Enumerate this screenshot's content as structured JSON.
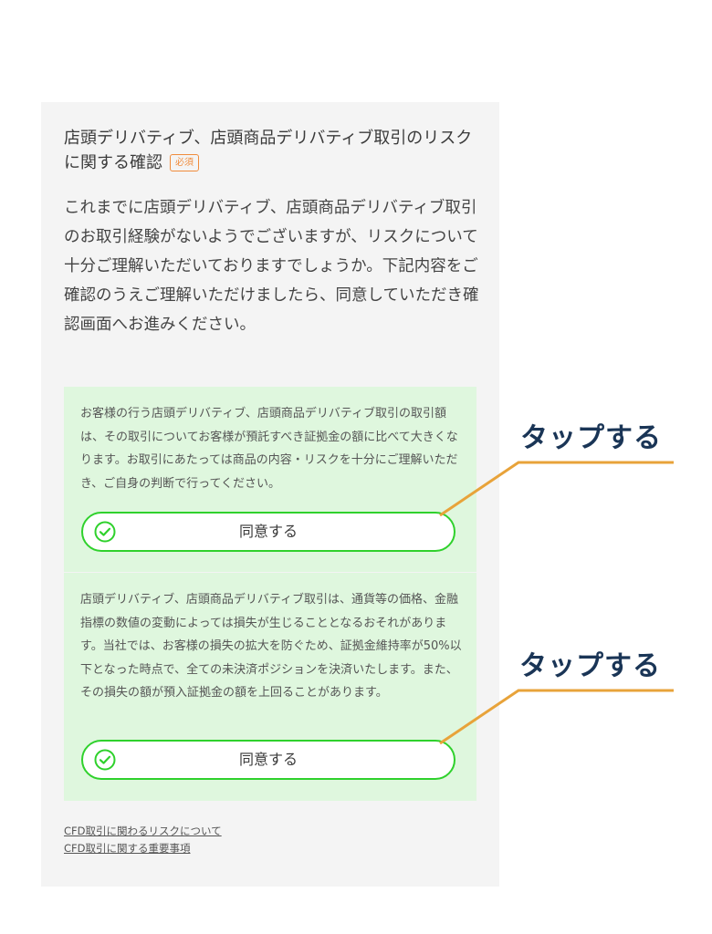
{
  "section": {
    "title": "店頭デリバティブ、店頭商品デリバティブ取引のリスクに関する確認",
    "required_badge": "必須",
    "intro": "これまでに店頭デリバティブ、店頭商品デリバティブ取引のお取引経験がないようでございますが、リスクについて十分ご理解いただいておりますでしょうか。下記内容をご確認のうえご理解いただけましたら、同意していただき確認画面へお進みください。"
  },
  "cards": [
    {
      "text": "お客様の行う店頭デリバティブ、店頭商品デリバティブ取引の取引額は、その取引についてお客様が預託すべき証拠金の額に比べて大きくなります。お取引にあたっては商品の内容・リスクを十分にご理解いただき、ご自身の判断で行ってください。",
      "button_label": "同意する",
      "icon": "check-circle-icon"
    },
    {
      "text": "店頭デリバティブ、店頭商品デリバティブ取引は、通貨等の価格、金融指標の数値の変動によっては損失が生じることとなるおそれがあります。当社では、お客様の損失の拡大を防ぐため、証拠金維持率が50%以下となった時点で、全ての未決済ポジションを決済いたします。また、その損失の額が預入証拠金の額を上回ることがあります。",
      "button_label": "同意する",
      "icon": "check-circle-icon"
    }
  ],
  "links": [
    "CFD取引に関わるリスクについて",
    "CFD取引に関する重要事項"
  ],
  "annotations": [
    "タップする",
    "タップする"
  ],
  "colors": {
    "accent_green": "#2fd12c",
    "card_bg": "#dff7de",
    "badge_orange": "#f08c3c",
    "annotation_text": "#1a3556",
    "callout_line": "#e8a33a"
  }
}
